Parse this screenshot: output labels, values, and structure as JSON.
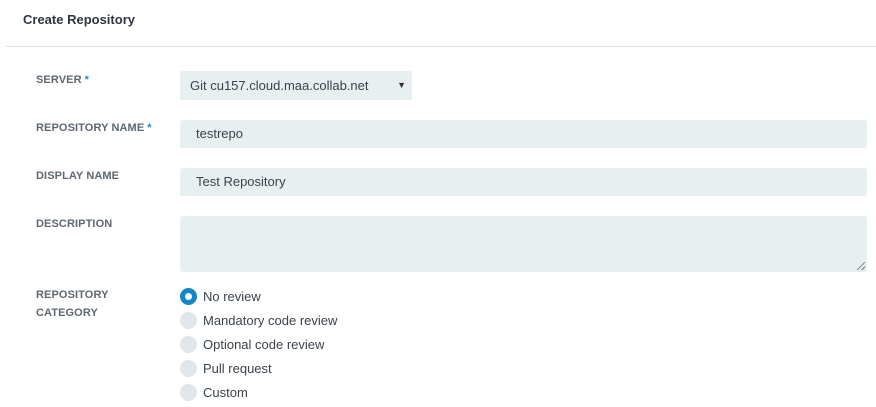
{
  "header": {
    "title": "Create Repository"
  },
  "form": {
    "server": {
      "label": "SERVER",
      "required_mark": "*",
      "value": "Git cu157.cloud.maa.collab.net"
    },
    "repository_name": {
      "label": "REPOSITORY NAME",
      "required_mark": "*",
      "value": "testrepo"
    },
    "display_name": {
      "label": "DISPLAY NAME",
      "value": "Test Repository"
    },
    "description": {
      "label": "DESCRIPTION",
      "value": ""
    },
    "category": {
      "label_line1": "REPOSITORY",
      "label_line2": "CATEGORY",
      "options": [
        {
          "label": "No review",
          "selected": true
        },
        {
          "label": "Mandatory code review",
          "selected": false
        },
        {
          "label": "Optional code review",
          "selected": false
        },
        {
          "label": "Pull request",
          "selected": false
        },
        {
          "label": "Custom",
          "selected": false
        }
      ]
    }
  },
  "colors": {
    "accent": "#1487c4",
    "field_bg": "#e8eff1",
    "required": "#1a8fc2"
  }
}
